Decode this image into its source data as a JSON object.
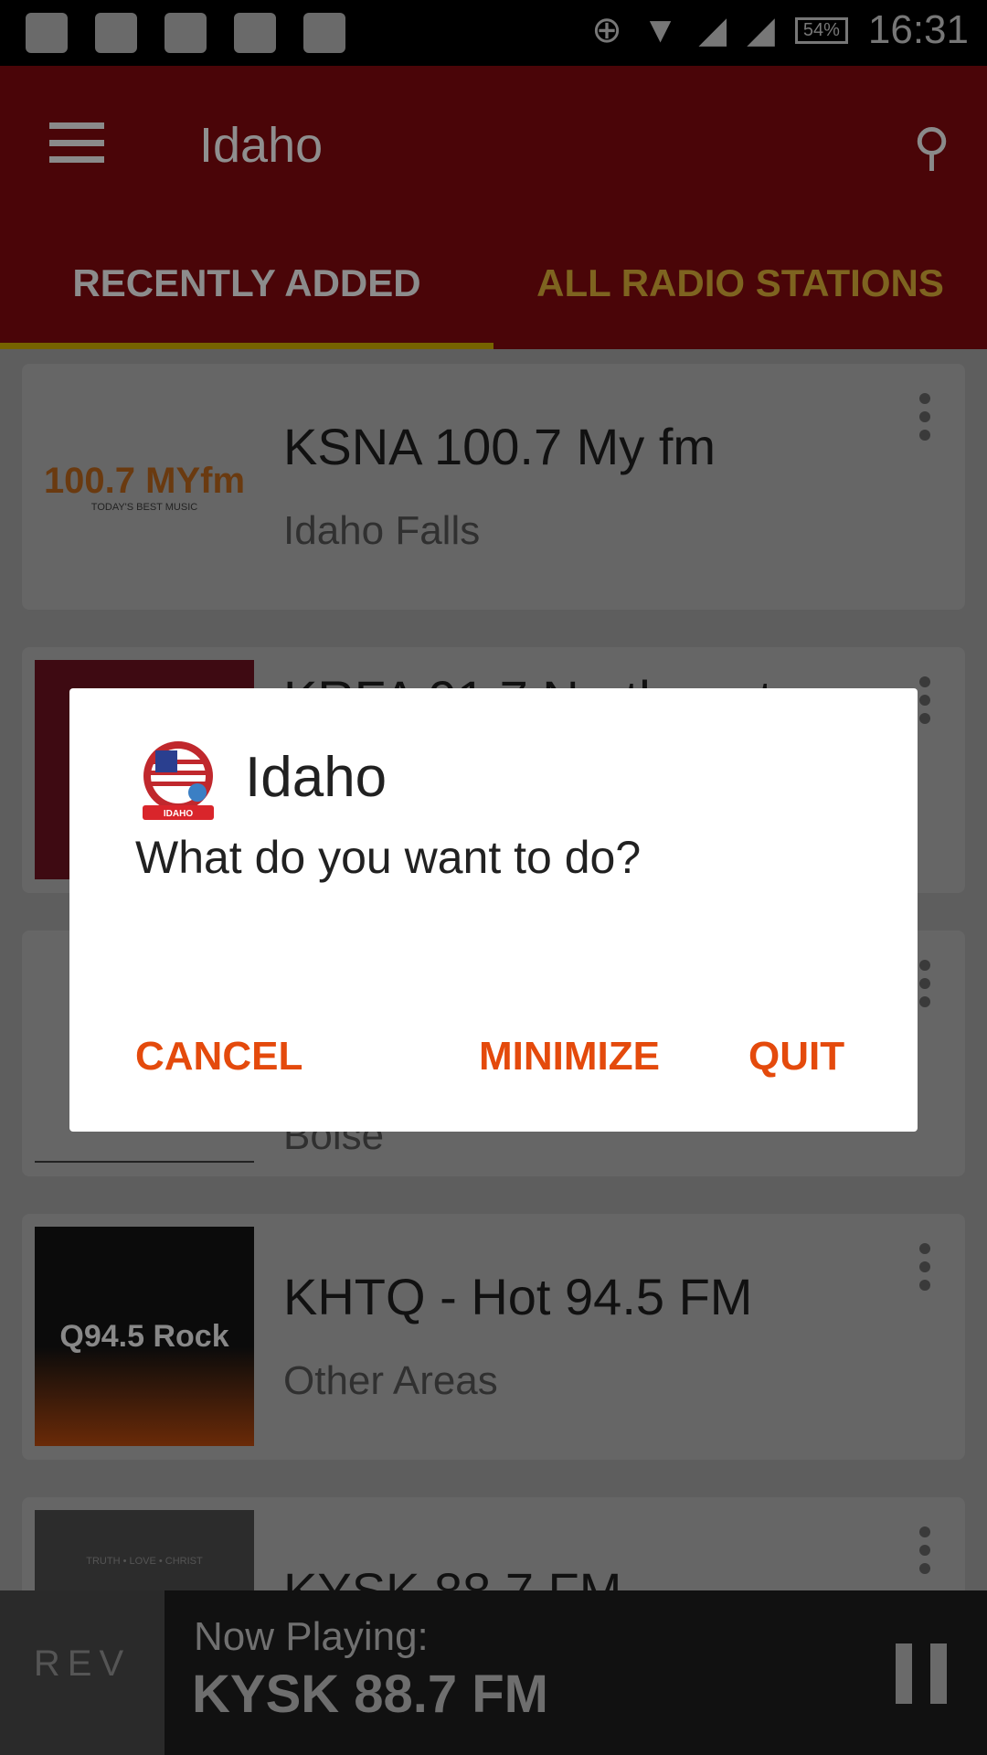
{
  "status_bar": {
    "time": "16:31",
    "battery": "54%",
    "icons": [
      "alert-icon",
      "cleaner-icon",
      "navigation-icon",
      "ghost-icon",
      "image-icon",
      "data-saver-icon",
      "wifi-icon",
      "signal-1-icon",
      "signal-2-icon",
      "battery-icon"
    ]
  },
  "app_bar": {
    "title": "Idaho",
    "menu_icon": "hamburger-icon",
    "search_icon": "search-icon"
  },
  "tabs": [
    {
      "label": "RECENTLY ADDED",
      "active": true
    },
    {
      "label": "ALL RADIO STATIONS",
      "active": false
    }
  ],
  "colors": {
    "app_bar": "#a50b10",
    "tab_indicator": "#f0c800",
    "accent": "#e44a0c"
  },
  "stations": [
    {
      "title": "KSNA 100.7 My fm",
      "location": "Idaho Falls",
      "logo_text": "100.7 MYfm",
      "logo_tagline": "TODAY'S BEST MUSIC"
    },
    {
      "title": "KRFA 91.7 Northwest",
      "location": ""
    },
    {
      "title": "",
      "location": "Boise"
    },
    {
      "title": "KHTQ - Hot 94.5 FM",
      "location": "Other Areas",
      "logo_text": "Q94.5 Rock"
    },
    {
      "title": "KYSK 88.7 FM",
      "location": "",
      "logo_text": "TRUTH • LOVE • CHRIST"
    }
  ],
  "dialog": {
    "title": "Idaho",
    "message": "What do you want to do?",
    "logo_text": "IDAHO",
    "buttons": {
      "cancel": "CANCEL",
      "minimize": "MINIMIZE",
      "quit": "QUIT"
    }
  },
  "now_playing": {
    "label": "Now Playing:",
    "station": "KYSK 88.7 FM",
    "logo_text": "REV"
  }
}
